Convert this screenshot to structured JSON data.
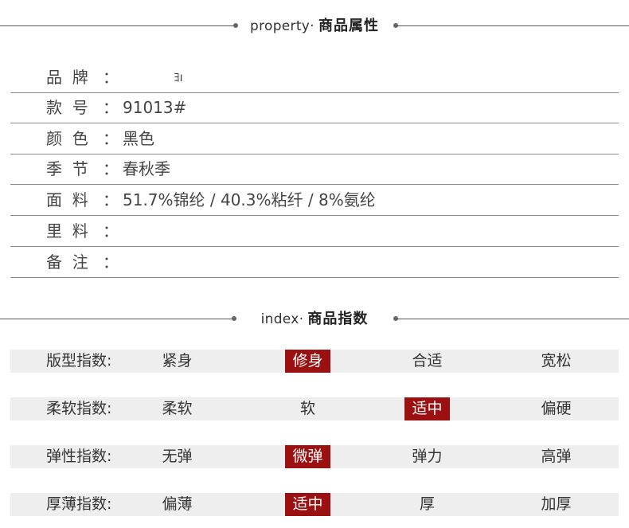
{
  "property_section": {
    "en": "property·",
    "zh": "商品属性",
    "rows": [
      {
        "label": "品  牌",
        "colon": "：",
        "value": ""
      },
      {
        "label": "款  号",
        "colon": "：",
        "value": "91013#"
      },
      {
        "label": "颜  色",
        "colon": "：",
        "value": "黑色"
      },
      {
        "label": "季  节",
        "colon": "：",
        "value": "春秋季"
      },
      {
        "label": "面  料",
        "colon": "：",
        "value": "51.7%锦纶 / 40.3%粘纤 / 8%氨纶"
      },
      {
        "label": "里  料",
        "colon": "：",
        "value": ""
      },
      {
        "label": "备  注",
        "colon": "：",
        "value": ""
      }
    ],
    "brand_mark": "ﾖı"
  },
  "index_section": {
    "en": "index·",
    "zh": "商品指数",
    "rows": [
      {
        "label": "版型指数:",
        "options": [
          "紧身",
          "修身",
          "合适",
          "宽松"
        ],
        "selected": 1
      },
      {
        "label": "柔软指数:",
        "options": [
          "柔软",
          "软",
          "适中",
          "偏硬"
        ],
        "selected": 2
      },
      {
        "label": "弹性指数:",
        "options": [
          "无弹",
          "微弹",
          "弹力",
          "高弹"
        ],
        "selected": 1
      },
      {
        "label": "厚薄指数:",
        "options": [
          "偏薄",
          "适中",
          "厚",
          "加厚"
        ],
        "selected": 1
      }
    ]
  },
  "colors": {
    "highlight": "#9b1010",
    "row_bg": "#eeeeee",
    "divider": "#8a8a8a"
  }
}
